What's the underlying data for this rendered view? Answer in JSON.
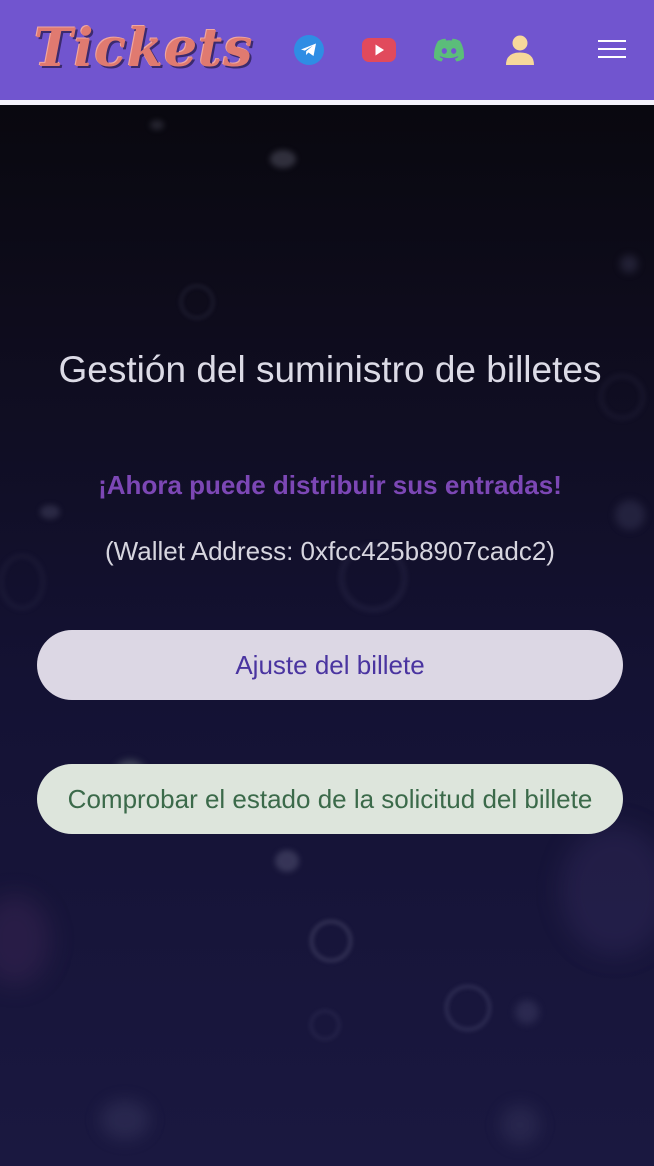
{
  "header": {
    "logo_text": "Tickets",
    "icons": [
      "telegram-icon",
      "youtube-icon",
      "discord-icon",
      "user-icon",
      "menu-icon"
    ]
  },
  "main": {
    "title": "Gestión del suministro de billetes",
    "subtitle": "¡Ahora puede distribuir sus entradas!",
    "wallet_text": "(Wallet Address: 0xfcc425b8907cadc2)",
    "buttons": {
      "adjust_label": "Ajuste del billete",
      "status_label": "Comprobar el estado de la solicitud del billete"
    }
  },
  "colors": {
    "header_bg": "#7155cf",
    "logo": "#e07a70",
    "subtitle": "#7c47b5",
    "adjust_button_bg": "#dcd7e4",
    "status_button_bg": "#dde5dc"
  }
}
